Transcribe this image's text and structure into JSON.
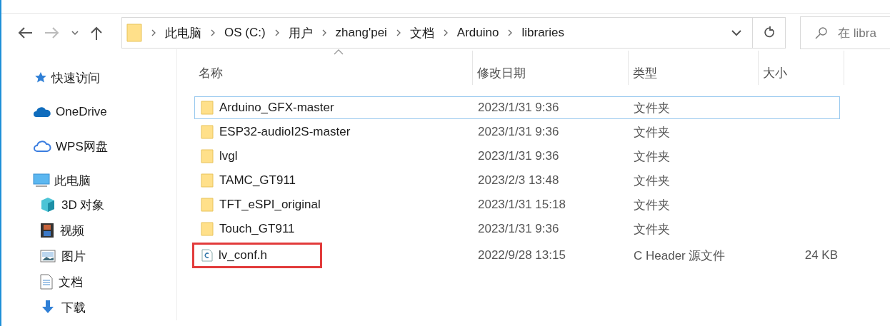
{
  "address_bar": {
    "crumbs": [
      "此电脑",
      "OS (C:)",
      "用户",
      "zhang'pei",
      "文档",
      "Arduino",
      "libraries"
    ]
  },
  "search": {
    "placeholder": "在 libra"
  },
  "sidebar": {
    "items": [
      {
        "label": "快速访问",
        "kind": "star"
      },
      {
        "label": "OneDrive",
        "kind": "cloud"
      },
      {
        "label": "WPS网盘",
        "kind": "cloud-outline"
      },
      {
        "label": "此电脑",
        "kind": "monitor",
        "children": [
          {
            "label": "3D 对象",
            "kind": "cube"
          },
          {
            "label": "视频",
            "kind": "film"
          },
          {
            "label": "图片",
            "kind": "image"
          },
          {
            "label": "文档",
            "kind": "document"
          },
          {
            "label": "下载",
            "kind": "download"
          }
        ]
      }
    ]
  },
  "table": {
    "columns": [
      {
        "label": "名称",
        "sorted": true
      },
      {
        "label": "修改日期",
        "sorted": false
      },
      {
        "label": "类型",
        "sorted": false
      },
      {
        "label": "大小",
        "sorted": false
      }
    ],
    "rows": [
      {
        "kind": "folder",
        "name": "Arduino_GFX-master",
        "date": "2023/1/31 9:36",
        "type": "文件夹",
        "focused": true,
        "highlighted": false
      },
      {
        "kind": "folder",
        "name": "ESP32-audioI2S-master",
        "date": "2023/1/31 9:36",
        "type": "文件夹",
        "focused": false,
        "highlighted": false
      },
      {
        "kind": "folder",
        "name": "lvgl",
        "date": "2023/1/31 9:36",
        "type": "文件夹",
        "focused": false,
        "highlighted": false
      },
      {
        "kind": "folder",
        "name": "TAMC_GT911",
        "date": "2023/2/3 13:48",
        "type": "文件夹",
        "focused": false,
        "highlighted": false
      },
      {
        "kind": "folder",
        "name": "TFT_eSPI_original",
        "date": "2023/1/31 15:18",
        "type": "文件夹",
        "focused": false,
        "highlighted": false
      },
      {
        "kind": "folder",
        "name": "Touch_GT911",
        "date": "2023/1/31 9:36",
        "type": "文件夹",
        "focused": false,
        "highlighted": false
      },
      {
        "kind": "c-file",
        "name": "lv_conf.h",
        "date": "2022/9/28 13:15",
        "type": "C Header 源文件",
        "size": "24 KB",
        "focused": false,
        "highlighted": true
      }
    ]
  }
}
